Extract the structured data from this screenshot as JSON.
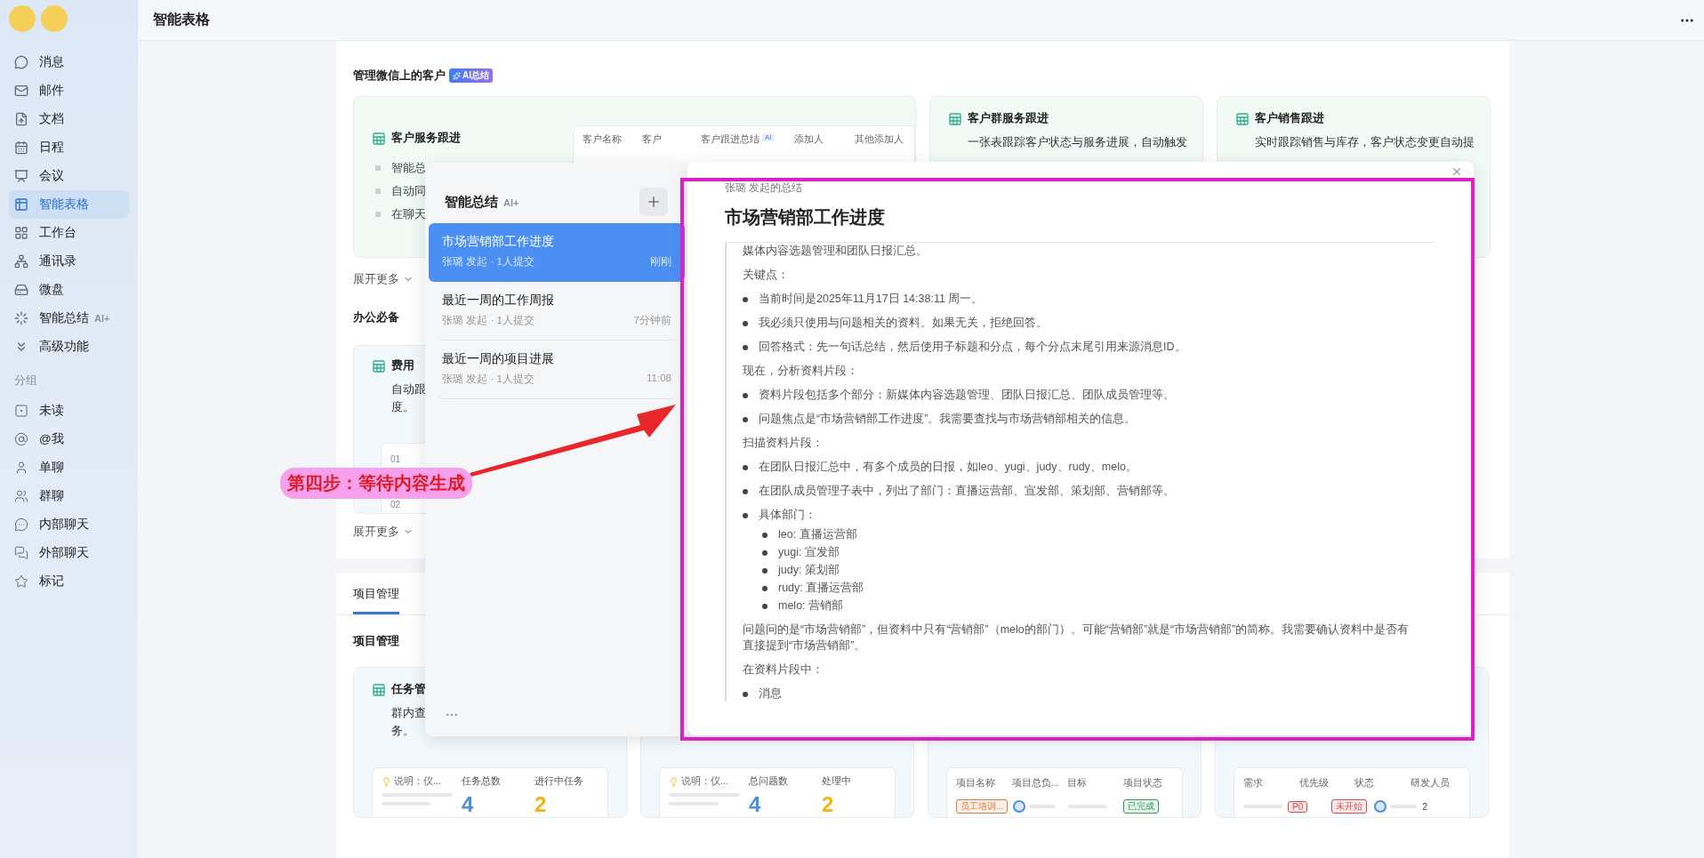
{
  "sidebar": {
    "nav": [
      {
        "label": "消息",
        "selected": false
      },
      {
        "label": "邮件",
        "selected": false
      },
      {
        "label": "文档",
        "selected": false
      },
      {
        "label": "日程",
        "selected": false
      },
      {
        "label": "会议",
        "selected": false
      },
      {
        "label": "智能表格",
        "selected": true
      },
      {
        "label": "工作台",
        "selected": false
      },
      {
        "label": "通讯录",
        "selected": false
      },
      {
        "label": "微盘",
        "selected": false
      },
      {
        "label": "智能总结",
        "badge": "AI+",
        "selected": false
      },
      {
        "label": "高级功能",
        "selected": false
      }
    ],
    "group_heading": "分组",
    "groups": [
      {
        "label": "未读",
        "selected": false
      },
      {
        "label": "@我",
        "selected": false
      },
      {
        "label": "单聊",
        "selected": false
      },
      {
        "label": "群聊",
        "selected": false
      },
      {
        "label": "内部聊天",
        "selected": false
      },
      {
        "label": "外部聊天",
        "selected": false
      },
      {
        "label": "标记",
        "selected": false
      }
    ]
  },
  "header": {
    "title": "智能表格"
  },
  "customers": {
    "title": "管理微信上的客户",
    "badge": "AI总结",
    "more": "展开更多",
    "cards": [
      {
        "kind": "preview",
        "title": "客户服务跟进",
        "bullets": [
          "智能总",
          "自动同",
          "在聊天"
        ],
        "columns": [
          {
            "label": "客户名称"
          },
          {
            "label": "客户"
          },
          {
            "label": "客户跟进总结",
            "tag": "AI"
          },
          {
            "label": "添加人"
          },
          {
            "label": "其他添加人"
          }
        ]
      },
      {
        "kind": "text",
        "title": "客户群服务跟进",
        "desc": "一张表跟踪客户状态与服务进展，自动触发"
      },
      {
        "kind": "text",
        "title": "客户销售跟进",
        "desc": "实时跟踪销售与库存，客户状态变更自动提"
      }
    ]
  },
  "office": {
    "title": "办公必备",
    "more": "展开更多",
    "cards": [
      {
        "title": "费用",
        "desc": [
          "自动跟",
          "度。"
        ],
        "rows": [
          "01",
          "02"
        ]
      }
    ]
  },
  "projects": {
    "tabs": [
      {
        "label": "项目管理",
        "selected": true
      }
    ],
    "title": "项目管理",
    "cards": [
      {
        "kind": "stats",
        "title": "任务管",
        "desc": [
          "群内查",
          "务。"
        ],
        "note": "说明：仪...",
        "stats": [
          {
            "label": "任务总数",
            "value": "4",
            "color": "#4a8fe0"
          },
          {
            "label": "进行中任务",
            "value": "2",
            "color": "#f2b410"
          }
        ]
      },
      {
        "kind": "stats",
        "note": "说明：仪...",
        "stats": [
          {
            "label": "总问题数",
            "value": "4",
            "color": "#4a8fe0"
          },
          {
            "label": "处理中",
            "value": "2",
            "color": "#f2b410"
          }
        ]
      },
      {
        "kind": "table",
        "columns": [
          "项目名称",
          "项目总负...",
          "目标",
          "项目状态"
        ],
        "cells": [
          {
            "kind": "tag",
            "text": "员工培训...",
            "color": "#e07b39"
          },
          {
            "kind": "person"
          },
          {
            "kind": "bar"
          },
          {
            "kind": "tag",
            "text": "已完成",
            "color": "#2e9e5b"
          }
        ]
      },
      {
        "kind": "table",
        "columns": [
          "需求",
          "优先级",
          "状态",
          "研发人员"
        ],
        "cells": [
          {
            "kind": "bar"
          },
          {
            "kind": "tag",
            "text": "P0",
            "color": "#e0474c"
          },
          {
            "kind": "tag",
            "text": "未开始",
            "color": "#e0474c"
          },
          {
            "kind": "person"
          },
          {
            "kind": "text",
            "text": "2"
          }
        ]
      }
    ]
  },
  "summary_list": {
    "title": "智能总结",
    "badge": "AI+",
    "items": [
      {
        "title": "市场营销部工作进度",
        "meta": "张璐 发起 · 1人提交",
        "time": "刚刚",
        "selected": true
      },
      {
        "title": "最近一周的工作周报",
        "meta": "张璐 发起 · 1人提交",
        "time": "7分钟前",
        "selected": false
      },
      {
        "title": "最近一周的项目进展",
        "meta": "张璐 发起 · 1人提交",
        "time": "11:08",
        "selected": false
      }
    ]
  },
  "summary": {
    "byline": "张璐 发起的总结",
    "title": "市场营销部工作进度",
    "blocks": [
      {
        "kind": "paragraph",
        "text": "媒体内容选题管理和团队日报汇总。"
      },
      {
        "kind": "paragraph",
        "text": "关键点："
      },
      {
        "kind": "bullet",
        "text": "当前时间是2025年11月17日 14:38:11 周一。"
      },
      {
        "kind": "bullet",
        "text": "我必须只使用与问题相关的资料。如果无关，拒绝回答。"
      },
      {
        "kind": "bullet",
        "text": "回答格式：先一句话总结，然后使用子标题和分点，每个分点末尾引用来源消息ID。"
      },
      {
        "kind": "paragraph",
        "text": "现在，分析资料片段："
      },
      {
        "kind": "bullet",
        "text": "资料片段包括多个部分：新媒体内容选题管理、团队日报汇总、团队成员管理等。"
      },
      {
        "kind": "bullet",
        "text": "问题焦点是“市场营销部工作进度”。我需要查找与市场营销部相关的信息。"
      },
      {
        "kind": "paragraph",
        "text": "扫描资料片段："
      },
      {
        "kind": "bullet",
        "text": "在团队日报汇总中，有多个成员的日报，如leo、yugi、judy、rudy、melo。"
      },
      {
        "kind": "bullet",
        "text": "在团队成员管理子表中，列出了部门：直播运营部、宣发部、策划部、营销部等。"
      },
      {
        "kind": "bullet",
        "text": "具体部门：",
        "children": [
          {
            "text": "leo: 直播运营部"
          },
          {
            "text": "yugi: 宣发部"
          },
          {
            "text": "judy: 策划部"
          },
          {
            "text": "rudy: 直播运营部"
          },
          {
            "text": "melo: 营销部"
          }
        ]
      },
      {
        "kind": "paragraph",
        "text": "问题问的是“市场营销部”，但资料中只有“营销部”（melo的部门）。可能“营销部”就是“市场营销部”的简称。我需要确认资料中是否有直接提到“市场营销部”。"
      },
      {
        "kind": "paragraph",
        "text": "在资料片段中："
      },
      {
        "kind": "bullet",
        "text": "消息"
      }
    ]
  },
  "annotation": {
    "label": "第四步：等待内容生成"
  }
}
